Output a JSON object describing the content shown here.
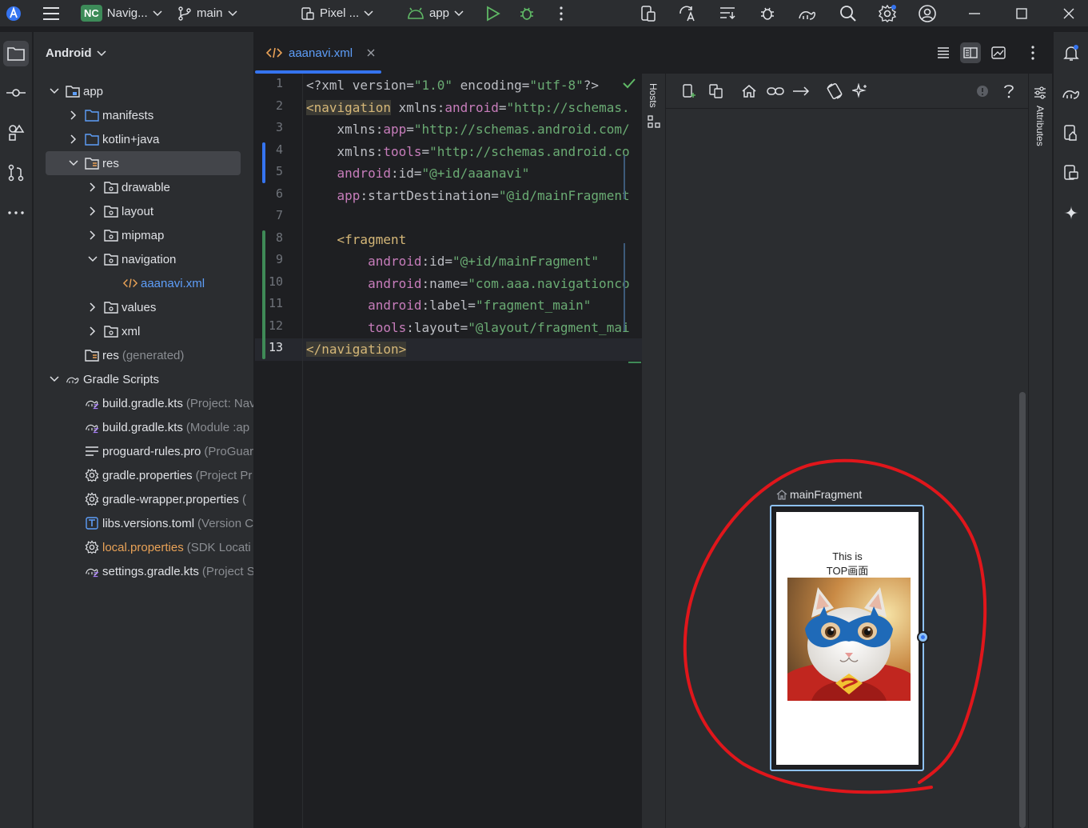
{
  "titlebar": {
    "project_badge": "NC",
    "project_name": "Navig...",
    "branch": "main",
    "device": "Pixel ...",
    "run_config": "app"
  },
  "project_panel": {
    "view_selector": "Android",
    "tree": [
      {
        "label": "app",
        "extra": ""
      },
      {
        "label": "manifests",
        "extra": ""
      },
      {
        "label": "kotlin+java",
        "extra": ""
      },
      {
        "label": "res",
        "extra": ""
      },
      {
        "label": "drawable",
        "extra": ""
      },
      {
        "label": "layout",
        "extra": ""
      },
      {
        "label": "mipmap",
        "extra": ""
      },
      {
        "label": "navigation",
        "extra": ""
      },
      {
        "label": "aaanavi.xml",
        "extra": ""
      },
      {
        "label": "values",
        "extra": ""
      },
      {
        "label": "xml",
        "extra": ""
      },
      {
        "label": "res",
        "extra": "(generated)"
      },
      {
        "label": "Gradle Scripts",
        "extra": ""
      },
      {
        "label": "build.gradle.kts",
        "extra": "(Project: Nav"
      },
      {
        "label": "build.gradle.kts",
        "extra": "(Module :ap"
      },
      {
        "label": "proguard-rules.pro",
        "extra": "(ProGuar"
      },
      {
        "label": "gradle.properties",
        "extra": "(Project Pr"
      },
      {
        "label": "gradle-wrapper.properties",
        "extra": "("
      },
      {
        "label": "libs.versions.toml",
        "extra": "(Version C"
      },
      {
        "label": "local.properties",
        "extra": "(SDK Locati"
      },
      {
        "label": "settings.gradle.kts",
        "extra": "(Project S"
      }
    ]
  },
  "editor": {
    "tab_label": "aaanavi.xml",
    "line_numbers": [
      "1",
      "2",
      "3",
      "4",
      "5",
      "6",
      "7",
      "8",
      "9",
      "10",
      "11",
      "12",
      "13"
    ],
    "lines": [
      [
        {
          "t": "pi",
          "v": "<?xml version="
        },
        {
          "t": "str",
          "v": "\"1.0\""
        },
        {
          "t": "pi",
          "v": " encoding="
        },
        {
          "t": "str",
          "v": "\"utf-8\""
        },
        {
          "t": "pi",
          "v": "?>"
        }
      ],
      [
        {
          "t": "tag",
          "v": "<navigation"
        },
        {
          "t": "txt",
          "v": " xmlns:"
        },
        {
          "t": "attr",
          "v": "android"
        },
        {
          "t": "txt",
          "v": "="
        },
        {
          "t": "str",
          "v": "\"http://schemas."
        }
      ],
      [
        {
          "t": "txt",
          "v": "    xmlns:"
        },
        {
          "t": "attr",
          "v": "app"
        },
        {
          "t": "txt",
          "v": "="
        },
        {
          "t": "str",
          "v": "\"http://schemas.android.com/"
        }
      ],
      [
        {
          "t": "txt",
          "v": "    xmlns:"
        },
        {
          "t": "attr",
          "v": "tools"
        },
        {
          "t": "txt",
          "v": "="
        },
        {
          "t": "str",
          "v": "\"http://schemas.android.co"
        }
      ],
      [
        {
          "t": "attr",
          "v": "    android"
        },
        {
          "t": "txt",
          "v": ":id="
        },
        {
          "t": "str",
          "v": "\"@+id/aaanavi\""
        }
      ],
      [
        {
          "t": "attr",
          "v": "    app"
        },
        {
          "t": "txt",
          "v": ":startDestination="
        },
        {
          "t": "str",
          "v": "\"@id/mainFragment"
        }
      ],
      [
        {
          "t": "txt",
          "v": ""
        }
      ],
      [
        {
          "t": "tag",
          "v": "    <fragment"
        }
      ],
      [
        {
          "t": "attr",
          "v": "        android"
        },
        {
          "t": "txt",
          "v": ":id="
        },
        {
          "t": "str",
          "v": "\"@+id/mainFragment\""
        }
      ],
      [
        {
          "t": "attr",
          "v": "        android"
        },
        {
          "t": "txt",
          "v": ":name="
        },
        {
          "t": "str",
          "v": "\"com.aaa.navigationco"
        }
      ],
      [
        {
          "t": "attr",
          "v": "        android"
        },
        {
          "t": "txt",
          "v": ":label="
        },
        {
          "t": "str",
          "v": "\"fragment_main\""
        }
      ],
      [
        {
          "t": "attr",
          "v": "        tools"
        },
        {
          "t": "txt",
          "v": ":layout="
        },
        {
          "t": "str",
          "v": "\"@layout/fragment_mai"
        }
      ],
      [
        {
          "t": "tag",
          "v": "</navigation>"
        }
      ]
    ]
  },
  "design": {
    "hosts_label": "Hosts",
    "attributes_label": "Attributes",
    "destination_label": "mainFragment",
    "phone_text_line1": "This is",
    "phone_text_line2": "TOP画面"
  },
  "colors": {
    "accent": "#3574f0",
    "annotation_red": "#e0161b",
    "selection_border": "#8ec1f5"
  }
}
